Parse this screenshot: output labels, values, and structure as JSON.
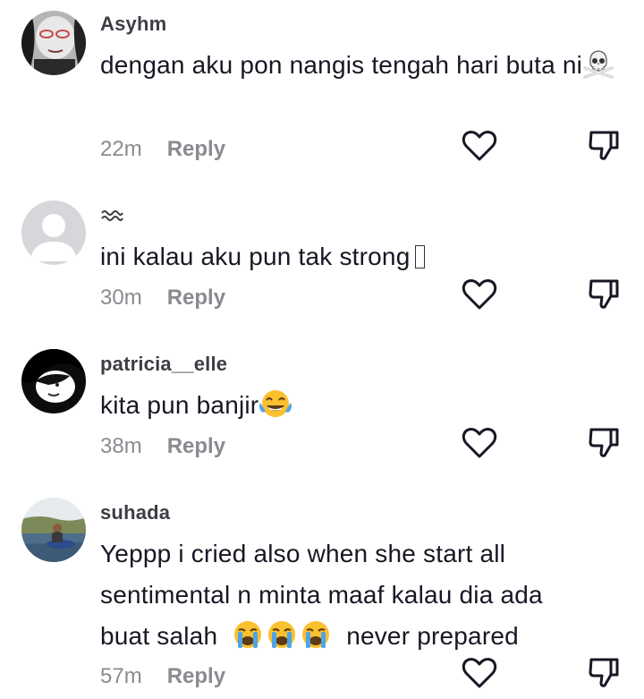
{
  "comments": [
    {
      "username": "Asyhm",
      "text": "dengan aku pon nangis tengah hari buta ni",
      "emoji": "skull-and-crossbones",
      "time": "22m",
      "reply": "Reply"
    },
    {
      "username": "〰",
      "text": "ini kalau aku pun tak strong",
      "emoji": "missing-glyph",
      "time": "30m",
      "reply": "Reply"
    },
    {
      "username": "patricia__elle",
      "text": "kita pun banjir",
      "emoji": "tears-of-joy",
      "time": "38m",
      "reply": "Reply"
    },
    {
      "username": "suhada",
      "text_line1": "Yeppp i cried also when she start all",
      "text_line2": "sentimental n minta maaf kalau dia ada",
      "text_line3_start": "buat salah",
      "text_line3_end": "never prepared",
      "emoji": "loudly-crying-face x3",
      "time": "57m",
      "reply": "Reply"
    }
  ],
  "icons": {
    "like": "heart-outline-icon",
    "dislike": "thumbs-down-outline-icon"
  },
  "colors": {
    "text": "#161823",
    "username": "#3d3d45",
    "meta": "#8a8b91",
    "icon": "#161823"
  }
}
